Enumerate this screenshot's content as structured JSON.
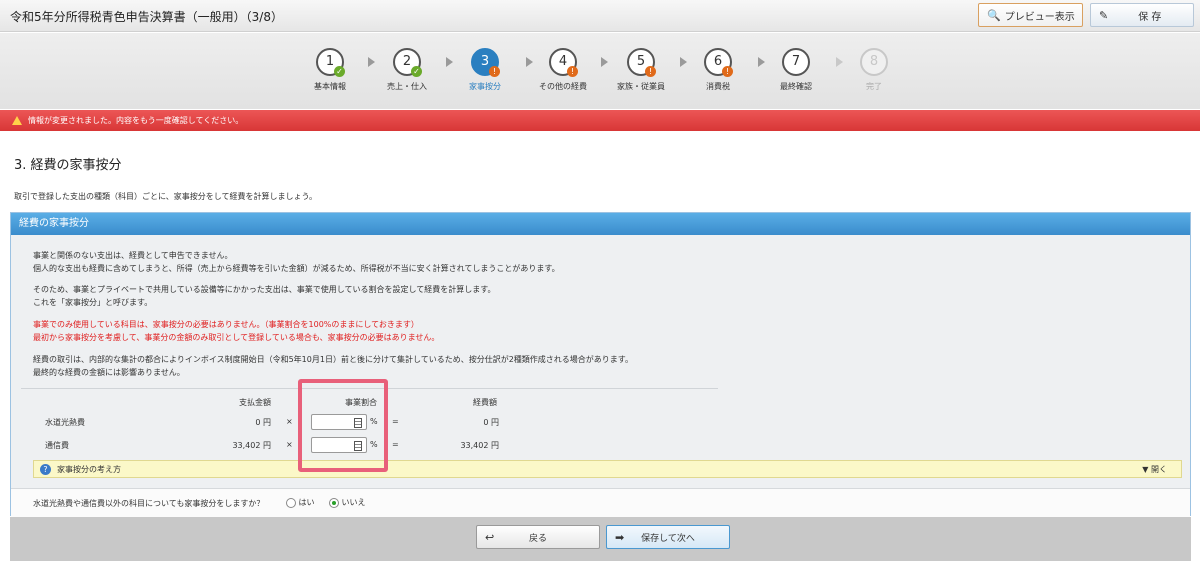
{
  "header": {
    "title": "令和5年分所得税青色申告決算書（一般用）（3/8）",
    "preview_label": "プレビュー表示",
    "save_label": "保 存"
  },
  "steps": [
    {
      "num": "1",
      "label": "基本情報",
      "state": "done"
    },
    {
      "num": "2",
      "label": "売上・仕入",
      "state": "done"
    },
    {
      "num": "3",
      "label": "家事按分",
      "state": "active"
    },
    {
      "num": "4",
      "label": "その他の経費",
      "state": "warn"
    },
    {
      "num": "5",
      "label": "家族・従業員",
      "state": "warn"
    },
    {
      "num": "6",
      "label": "消費税",
      "state": "warn"
    },
    {
      "num": "7",
      "label": "最終確認",
      "state": "plain"
    },
    {
      "num": "8",
      "label": "完了",
      "state": "disabled"
    }
  ],
  "alert": {
    "text": "情報が変更されました。内容をもう一度確認してください。",
    "color": "#e04444"
  },
  "page": {
    "title": "3. 経費の家事按分",
    "intro": "取引で登録した支出の種類（科目）ごとに、家事按分をして経費を計算しましょう。"
  },
  "panel": {
    "header": "経費の家事按分",
    "p1_line1": "事業と関係のない支出は、経費として申告できません。",
    "p1_line2": "個人的な支出も経費に含めてしまうと、所得（売上から経費等を引いた金額）が減るため、所得税が不当に安く計算されてしまうことがあります。",
    "p2_line1": "そのため、事業とプライベートで共用している設備等にかかった支出は、事業で使用している割合を設定して経費を計算します。",
    "p2_line2": "これを「家事按分」と呼びます。",
    "red_line1": "事業でのみ使用している科目は、家事按分の必要はありません。（事業割合を100%のままにしておきます）",
    "red_line2": "最初から家事按分を考慮して、事業分の金額のみ取引として登録している場合も、家事按分の必要はありません。",
    "p3_line1": "経費の取引は、内部的な集計の都合によりインボイス制度開始日（令和5年10月1日）前と後に分けて集計しているため、按分仕訳が2種類作成される場合があります。",
    "p3_line2": "最終的な経費の金額には影響ありません。"
  },
  "table": {
    "col_paid": "支払金額",
    "col_ratio": "事業割合",
    "col_expense": "経費額",
    "times": "×",
    "equals": "=",
    "pct": "%",
    "rows": [
      {
        "name": "水道光熱費",
        "paid": "0 円",
        "ratio": "",
        "expense": "0 円"
      },
      {
        "name": "通信費",
        "paid": "33,402 円",
        "ratio": "",
        "expense": "33,402 円"
      }
    ]
  },
  "advice": {
    "label": "家事按分の考え方",
    "open_label": "開く"
  },
  "question": {
    "text": "水道光熱費や通信費以外の科目についても家事按分をしますか？",
    "yes": "はい",
    "no": "いいえ",
    "selected": "いいえ"
  },
  "footer": {
    "back_label": "戻る",
    "next_label": "保存して次へ"
  }
}
